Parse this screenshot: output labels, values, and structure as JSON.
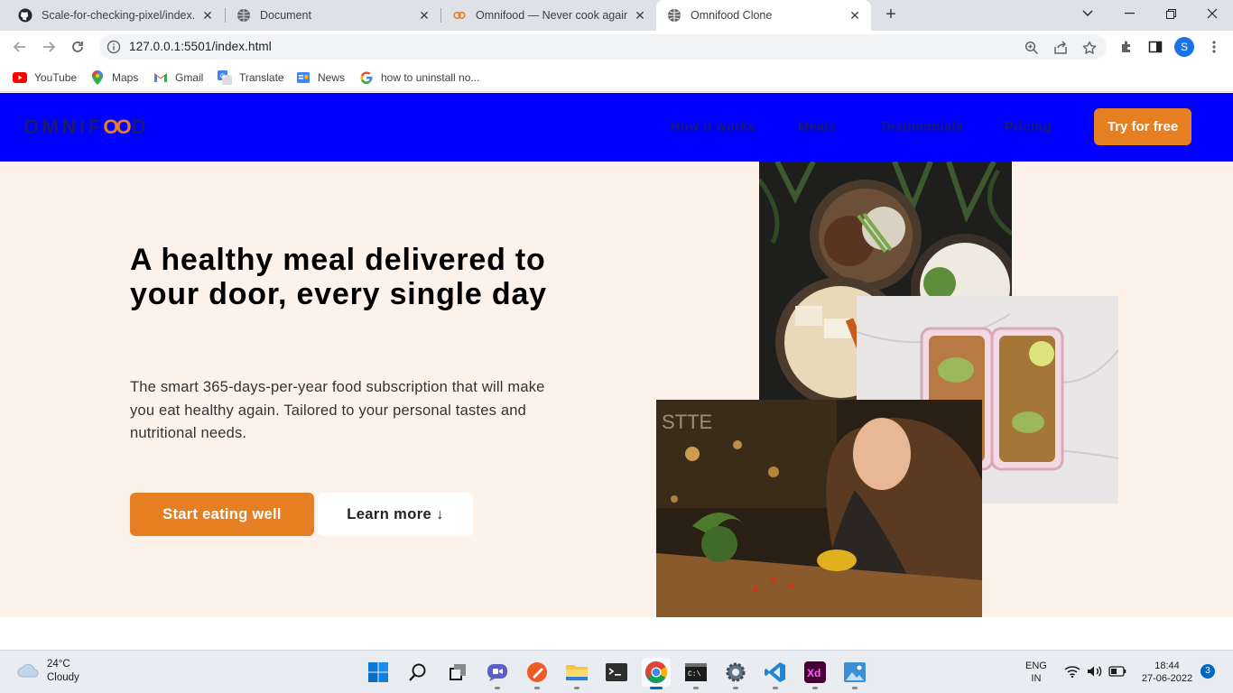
{
  "browser": {
    "tabs": [
      {
        "title": "Scale-for-checking-pixel/index.ht",
        "icon": "github-icon",
        "active": false
      },
      {
        "title": "Document",
        "icon": "globe-icon",
        "active": false
      },
      {
        "title": "Omnifood — Never cook again!",
        "icon": "omnifood-icon",
        "active": false
      },
      {
        "title": "Omnifood Clone",
        "icon": "globe-icon",
        "active": true
      }
    ],
    "url": "127.0.0.1:5501/index.html",
    "profile_initial": "S",
    "bookmarks": [
      {
        "label": "YouTube",
        "icon": "youtube-icon"
      },
      {
        "label": "Maps",
        "icon": "maps-icon"
      },
      {
        "label": "Gmail",
        "icon": "gmail-icon"
      },
      {
        "label": "Translate",
        "icon": "translate-icon"
      },
      {
        "label": "News",
        "icon": "news-icon"
      },
      {
        "label": "how to uninstall no...",
        "icon": "google-icon"
      }
    ]
  },
  "site": {
    "logo_part1": "OMNIF",
    "logo_oo": "OO",
    "logo_part2": "D",
    "nav": [
      "How it works",
      "Meals",
      "Testimonials",
      "Pricing"
    ],
    "cta": "Try for free",
    "colors": {
      "header_bg": "#0000ff",
      "accent": "#e67e22",
      "hero_bg": "#fdf2e9",
      "nav_text": "#1a1a6e"
    },
    "hero": {
      "title": "A healthy meal delivered to your door, every single day",
      "description": "The smart 365-days-per-year food subscription that will make you eat healthy again. Tailored to your personal tastes and nutritional needs.",
      "primary_button": "Start eating well",
      "secondary_button": "Learn more ↓"
    }
  },
  "taskbar": {
    "weather_temp": "24°C",
    "weather_desc": "Cloudy",
    "language_top": "ENG",
    "language_bottom": "IN",
    "time": "18:44",
    "date": "27-06-2022",
    "notification_count": "3"
  }
}
